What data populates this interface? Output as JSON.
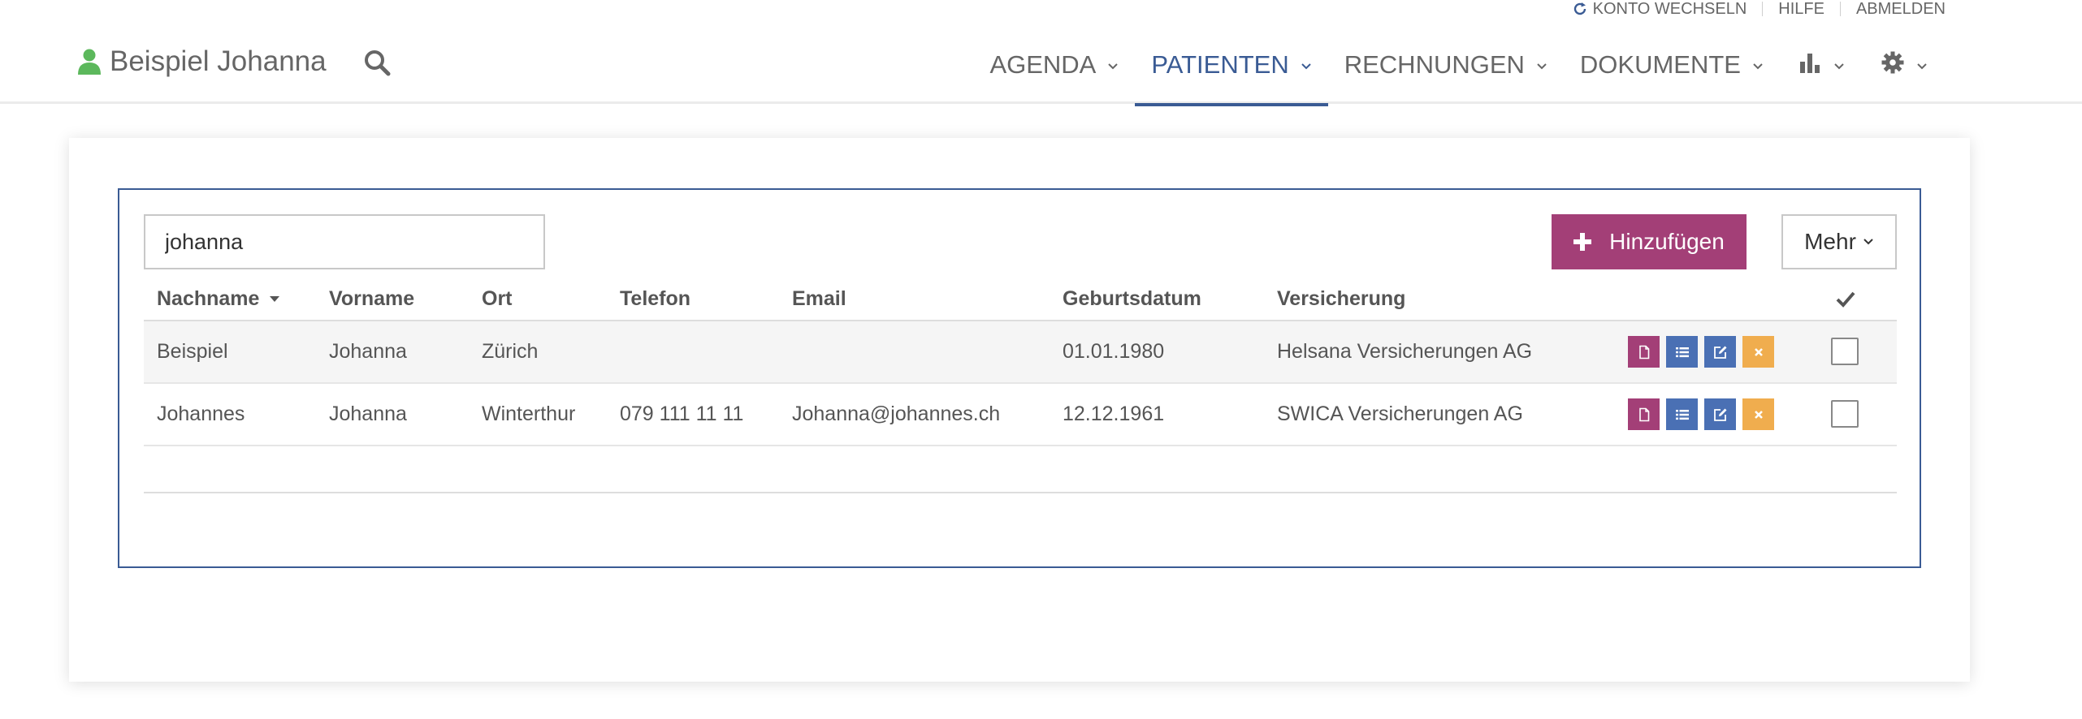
{
  "topbar": {
    "switch_account": "KONTO WECHSELN",
    "help": "HILFE",
    "logout": "ABMELDEN"
  },
  "brand": {
    "user_name": "Beispiel Johanna",
    "user_icon": "user-icon",
    "search_icon": "search-icon"
  },
  "nav": {
    "items": [
      {
        "label": "AGENDA"
      },
      {
        "label": "PATIENTEN",
        "active": true
      },
      {
        "label": "RECHNUNGEN"
      },
      {
        "label": "DOKUMENTE"
      }
    ],
    "stats_icon": "bar-chart-icon",
    "settings_icon": "gear-icon"
  },
  "search": {
    "value": "johanna"
  },
  "toolbar": {
    "add_label": "Hinzufügen",
    "more_label": "Mehr"
  },
  "table": {
    "columns": [
      "Nachname",
      "Vorname",
      "Ort",
      "Telefon",
      "Email",
      "Geburtsdatum",
      "Versicherung"
    ],
    "sorted_column": "Nachname",
    "rows": [
      {
        "nachname": "Beispiel",
        "vorname": "Johanna",
        "ort": "Zürich",
        "telefon": "",
        "email": "",
        "geburtsdatum": "01.01.1980",
        "versicherung": "Helsana Versicherungen AG"
      },
      {
        "nachname": "Johannes",
        "vorname": "Johanna",
        "ort": "Winterthur",
        "telefon": "079 111 11 11",
        "email": "Johanna@johannes.ch",
        "geburtsdatum": "12.12.1961",
        "versicherung": "SWICA Versicherungen AG"
      }
    ]
  },
  "colors": {
    "accent": "#3a5b94",
    "add_button": "#a33f77",
    "action_blue": "#4a70b4",
    "action_orange": "#f0ad4e",
    "user_icon": "#5cb85c"
  }
}
